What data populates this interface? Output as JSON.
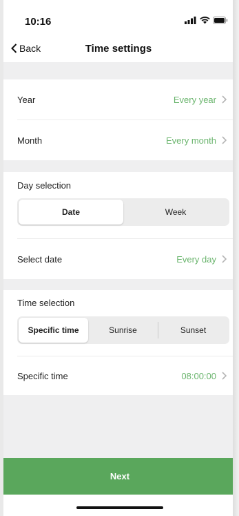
{
  "status_bar": {
    "time": "10:16",
    "icons": [
      "signal-icon",
      "wifi-icon",
      "battery-icon"
    ]
  },
  "nav": {
    "back_label": "Back",
    "title": "Time settings"
  },
  "year_row": {
    "label": "Year",
    "value": "Every year"
  },
  "month_row": {
    "label": "Month",
    "value": "Every month"
  },
  "day_selection": {
    "label": "Day selection",
    "options": [
      "Date",
      "Week"
    ],
    "selected": "Date"
  },
  "select_date_row": {
    "label": "Select date",
    "value": "Every day"
  },
  "time_selection": {
    "label": "Time selection",
    "options": [
      "Specific time",
      "Sunrise",
      "Sunset"
    ],
    "selected": "Specific time"
  },
  "specific_time_row": {
    "label": "Specific time",
    "value": "08:00:00"
  },
  "next_button": "Next",
  "colors": {
    "accent_green": "#5aa75c",
    "value_green": "#6bb56e",
    "background": "#efeff0"
  }
}
